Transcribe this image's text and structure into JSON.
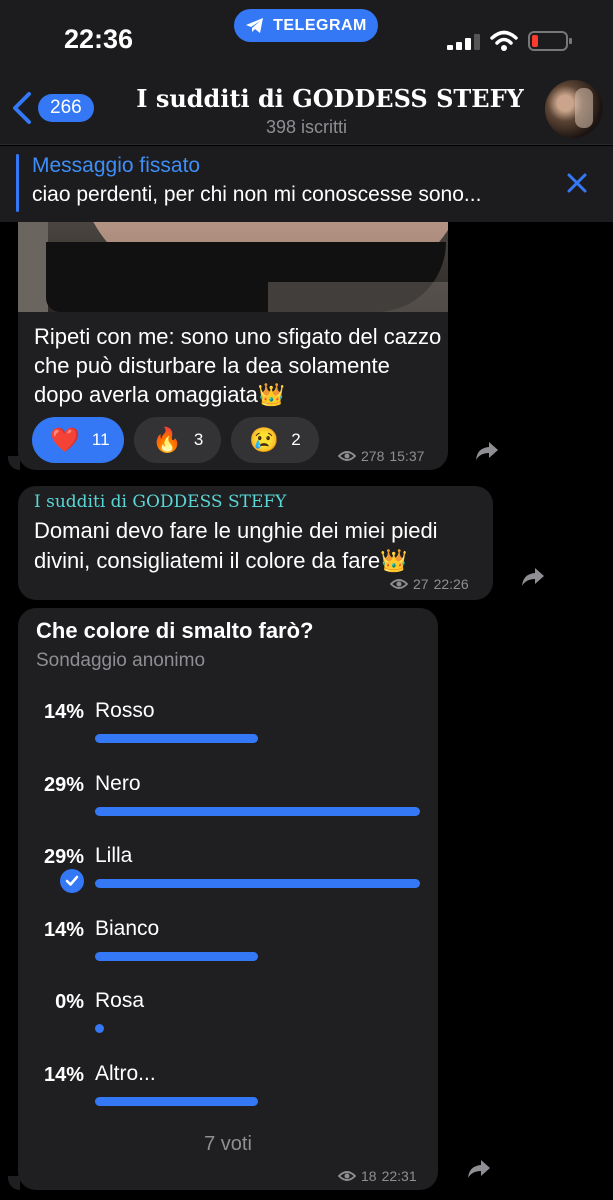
{
  "status_bar": {
    "time": "22:36",
    "app_pill": "TELEGRAM"
  },
  "header": {
    "back_count": "266",
    "title": "I sudditi di GODDESS STEFY",
    "subtitle": "398 iscritti"
  },
  "pinned": {
    "title": "Messaggio fissato",
    "text": "ciao perdenti, per chi non mi conoscesse sono..."
  },
  "messages": [
    {
      "text": "Ripeti con me: sono uno sfigato del cazzo  che può disturbare la dea solamente dopo averla omaggiata👑",
      "reactions": [
        {
          "emoji": "❤️",
          "count": "11",
          "active": true
        },
        {
          "emoji": "🔥",
          "count": "3",
          "active": false
        },
        {
          "emoji": "😢",
          "count": "2",
          "active": false
        }
      ],
      "views": "278",
      "time": "15:37"
    },
    {
      "author": "I sudditi di GODDESS STEFY",
      "text": "Domani devo fare le unghie dei miei piedi divini, consigliatemi il colore da fare👑",
      "views": "27",
      "time": "22:26"
    }
  ],
  "poll": {
    "question": "Che colore di smalto farò?",
    "type": "Sondaggio anonimo",
    "options": [
      {
        "percent": "14%",
        "label": "Rosso",
        "fraction": 0.5,
        "chosen": false
      },
      {
        "percent": "29%",
        "label": "Nero",
        "fraction": 1.0,
        "chosen": false
      },
      {
        "percent": "29%",
        "label": "Lilla",
        "fraction": 1.0,
        "chosen": true
      },
      {
        "percent": "14%",
        "label": "Bianco",
        "fraction": 0.5,
        "chosen": false
      },
      {
        "percent": "0%",
        "label": "Rosa",
        "fraction": 0.0,
        "chosen": false
      },
      {
        "percent": "14%",
        "label": "Altro...",
        "fraction": 0.5,
        "chosen": false
      }
    ],
    "votes": "7 voti",
    "views": "18",
    "time": "22:31"
  },
  "colors": {
    "accent": "#3478f6",
    "bubble": "#1f1f21",
    "author": "#5ad6d6"
  }
}
